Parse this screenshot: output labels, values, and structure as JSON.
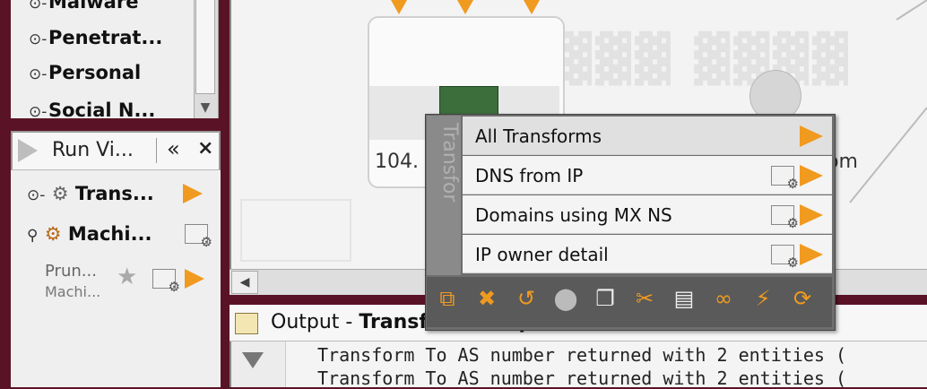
{
  "palette": {
    "items": [
      {
        "label": "Malware",
        "icon": "pin-icon"
      },
      {
        "label": "Penetrat...",
        "icon": "pin-icon"
      },
      {
        "label": "Personal",
        "icon": "pin-icon"
      },
      {
        "label": "Social N...",
        "icon": "pin-icon"
      }
    ]
  },
  "run_view": {
    "title": "Run Vi...",
    "collapse_glyph": "«",
    "close_glyph": "×",
    "items": [
      {
        "label": "Trans...",
        "icon": "gear-icon"
      },
      {
        "label": "Machi...",
        "icon": "machine-gear-icon"
      }
    ],
    "pruned": {
      "title": "Prun...",
      "subtitle": "Machi..."
    }
  },
  "graph": {
    "node_label": "104.",
    "other_label": "om"
  },
  "popup": {
    "tab_label": "Transfor",
    "items": [
      {
        "label": "All Transforms",
        "active": true
      },
      {
        "label": "DNS from IP",
        "active": false
      },
      {
        "label": "Domains using MX NS",
        "active": false
      },
      {
        "label": "IP owner detail",
        "active": false
      }
    ],
    "toolbar_icons": [
      "select-children-icon",
      "delete-icon",
      "change-type-icon",
      "merge-icon",
      "copy-icon",
      "cut-icon",
      "paste-icon",
      "link-icon",
      "run-transform-icon",
      "refresh-icon"
    ]
  },
  "output": {
    "title_prefix": "Output - ",
    "title_bold": "Transform Output",
    "lines": [
      "Transform To AS number returned with 2 entities (",
      "Transform To AS number returned with 2 entities ("
    ]
  },
  "colors": {
    "accent": "#f09a1f",
    "frame": "#5a1326"
  }
}
